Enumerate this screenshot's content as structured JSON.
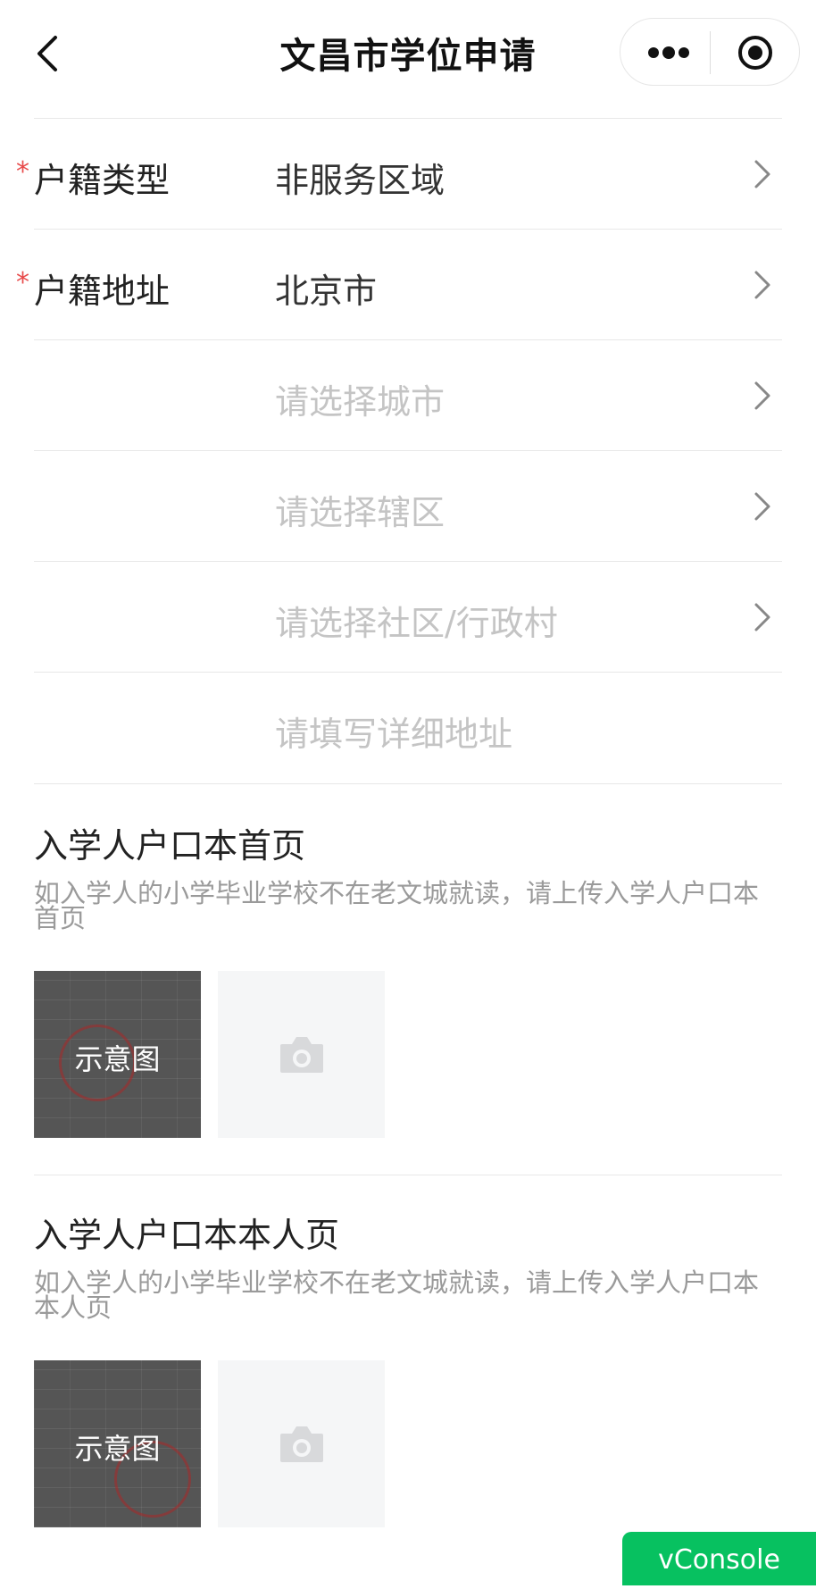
{
  "header": {
    "title": "文昌市学位申请"
  },
  "form": {
    "rows": [
      {
        "label": "户籍类型",
        "required": "*",
        "value": "非服务区域",
        "placeholder": false
      },
      {
        "label": "户籍地址",
        "required": "*",
        "value": "北京市",
        "placeholder": false
      },
      {
        "label": "",
        "required": "",
        "value": "请选择城市",
        "placeholder": true
      },
      {
        "label": "",
        "required": "",
        "value": "请选择辖区",
        "placeholder": true
      },
      {
        "label": "",
        "required": "",
        "value": "请选择社区/行政村",
        "placeholder": true
      },
      {
        "label": "",
        "required": "",
        "value": "请填写详细地址",
        "placeholder": true
      }
    ]
  },
  "uploads": [
    {
      "title": "入学人户口本首页",
      "description_line1": "如入学人的小学毕业学校不在老文城就读，请上传入学人户口本",
      "description_line2": "首页",
      "sample_label": "示意图"
    },
    {
      "title": "入学人户口本本人页",
      "description_line1": "如入学人的小学毕业学校不在老文城就读，请上传入学人户口本",
      "description_line2": "本人页",
      "sample_label": "示意图"
    }
  ],
  "footer": {
    "vconsole_label": "vConsole"
  },
  "colors": {
    "required": "#e84a4a",
    "placeholder": "#c4c4c4",
    "vconsole": "#07c160"
  }
}
